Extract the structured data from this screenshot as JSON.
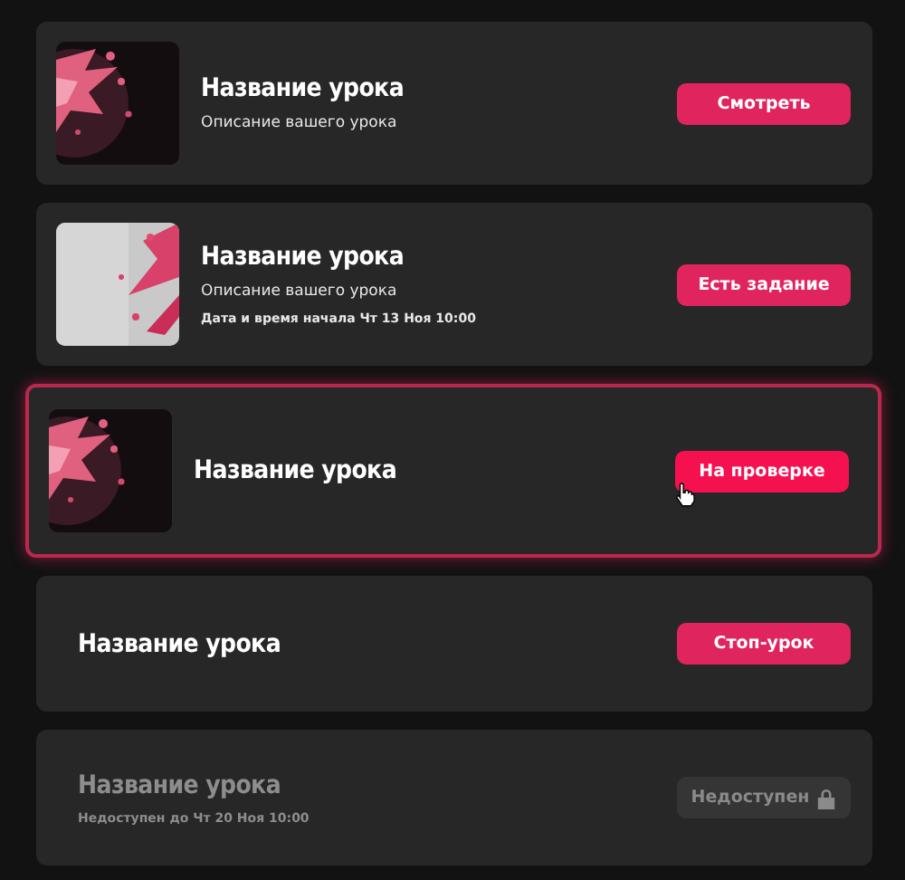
{
  "lessons": [
    {
      "title": "Название урока",
      "description": "Описание вашего урока",
      "highlighted": false,
      "disabled": false,
      "button": {
        "label": "Смотреть",
        "disabled": false
      }
    },
    {
      "title": "Название урока",
      "description": "Описание вашего урока",
      "date": "Дата и время начала Чт 13 Ноя 10:00",
      "highlighted": false,
      "disabled": false,
      "button": {
        "label": "Есть задание",
        "disabled": false
      }
    },
    {
      "title": "Название урока",
      "highlighted": true,
      "disabled": false,
      "button": {
        "label": "На проверке",
        "disabled": false
      }
    },
    {
      "title": "Название урока",
      "highlighted": false,
      "disabled": false,
      "button": {
        "label": "Стоп-урок",
        "disabled": false
      }
    },
    {
      "title": "Название урока",
      "date": "Недоступен до Чт 20 Ноя 10:00",
      "highlighted": false,
      "disabled": true,
      "button": {
        "label": "Недоступен",
        "disabled": true
      }
    }
  ]
}
